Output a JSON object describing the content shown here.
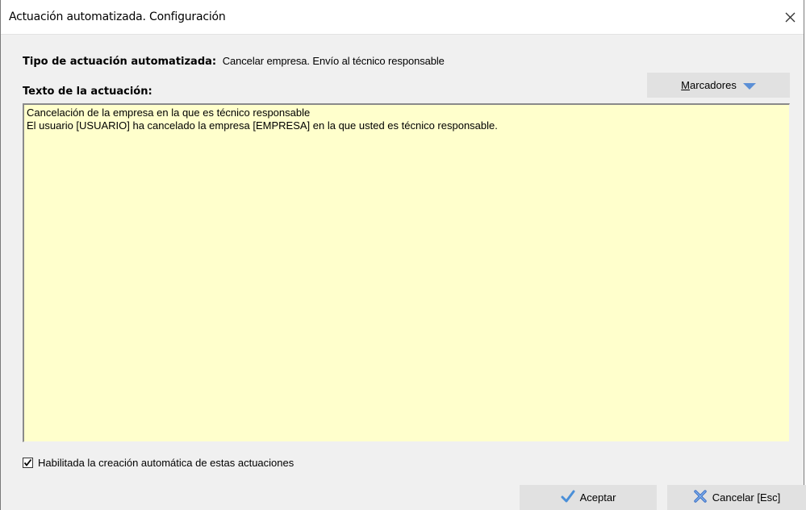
{
  "window": {
    "title": "Actuación automatizada. Configuración"
  },
  "tipo": {
    "label": "Tipo de actuación automatizada:",
    "value": "Cancelar empresa. Envío al técnico responsable"
  },
  "texto": {
    "label": "Texto de la actuación:",
    "content": "Cancelación de la empresa en la que es técnico responsable\nEl usuario [USUARIO] ha cancelado la empresa [EMPRESA] en la que usted es técnico responsable."
  },
  "marcadores": {
    "label_first": "M",
    "label_rest": "arcadores"
  },
  "checkbox": {
    "label": "Habilitada la creación automática de estas actuaciones",
    "checked": true
  },
  "buttons": {
    "aceptar": "Aceptar",
    "cancelar": "Cancelar [Esc]"
  },
  "colors": {
    "textarea_bg": "#ffffcc",
    "accent_blue": "#5b8fd6"
  },
  "icons": {
    "close": "close-icon",
    "dropdown": "triangle-down-icon",
    "accept": "check-icon",
    "cancel": "x-icon"
  }
}
